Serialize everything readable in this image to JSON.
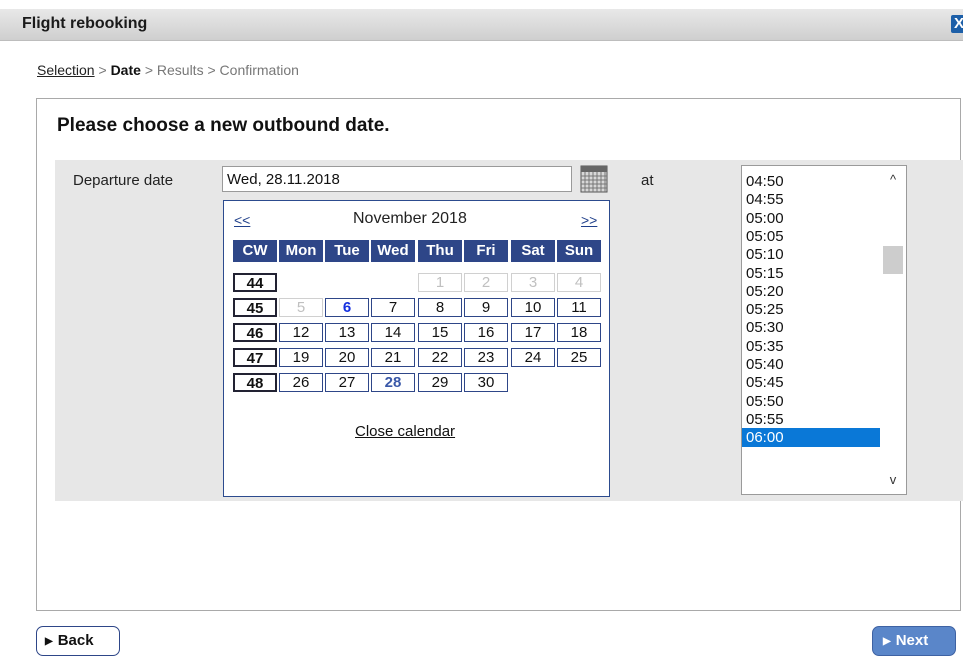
{
  "window": {
    "title": "Flight rebooking",
    "close_glyph": "X",
    "close_icon": "close-icon"
  },
  "breadcrumb": {
    "step1": "Selection",
    "sep": ">",
    "step2": "Date",
    "step3": "Results",
    "step4": "Confirmation"
  },
  "heading": "Please choose a new outbound date.",
  "departure": {
    "label": "Departure date",
    "value": "Wed, 28.11.2018",
    "calendar_icon": "calendar-icon",
    "at_label": "at"
  },
  "calendar": {
    "prev": "<<",
    "next": ">>",
    "month": "November 2018",
    "headers": [
      "CW",
      "Mon",
      "Tue",
      "Wed",
      "Thu",
      "Fri",
      "Sat",
      "Sun"
    ],
    "weeks": [
      {
        "cw": "44",
        "days": [
          "",
          "",
          "",
          "1",
          "2",
          "3",
          "4"
        ]
      },
      {
        "cw": "45",
        "days": [
          "5",
          "6",
          "7",
          "8",
          "9",
          "10",
          "11"
        ]
      },
      {
        "cw": "46",
        "days": [
          "12",
          "13",
          "14",
          "15",
          "16",
          "17",
          "18"
        ]
      },
      {
        "cw": "47",
        "days": [
          "19",
          "20",
          "21",
          "22",
          "23",
          "24",
          "25"
        ]
      },
      {
        "cw": "48",
        "days": [
          "26",
          "27",
          "28",
          "29",
          "30",
          "",
          ""
        ]
      }
    ],
    "disabled_days": [
      "1",
      "2",
      "3",
      "4",
      "5"
    ],
    "today": "6",
    "selected": "28",
    "close_label": "Close calendar"
  },
  "times": {
    "items": [
      "04:50",
      "04:55",
      "05:00",
      "05:05",
      "05:10",
      "05:15",
      "05:20",
      "05:25",
      "05:30",
      "05:35",
      "05:40",
      "05:45",
      "05:50",
      "05:55",
      "06:00"
    ],
    "selected": "06:00",
    "scroll_up_glyph": "^",
    "scroll_down_glyph": "v"
  },
  "buttons": {
    "back": "Back",
    "next": "Next"
  },
  "colors": {
    "header_blue": "#2e4688",
    "selection_blue": "#0a78d7",
    "next_button": "#5a86c9"
  }
}
